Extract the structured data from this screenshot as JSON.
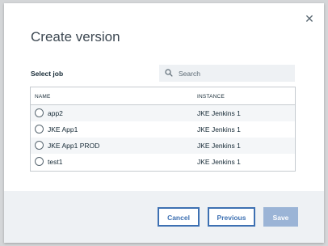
{
  "dialog": {
    "title": "Create version",
    "close_glyph": "✕"
  },
  "job_select": {
    "label": "Select job",
    "search": {
      "placeholder": "Search",
      "icon": "search-icon"
    },
    "columns": [
      "NAME",
      "INSTANCE"
    ],
    "rows": [
      {
        "name": "app2",
        "instance": "JKE Jenkins 1"
      },
      {
        "name": "JKE App1",
        "instance": "JKE Jenkins 1"
      },
      {
        "name": "JKE App1 PROD",
        "instance": "JKE Jenkins 1"
      },
      {
        "name": "test1",
        "instance": "JKE Jenkins 1"
      }
    ]
  },
  "footer": {
    "cancel_label": "Cancel",
    "previous_label": "Previous",
    "save_label": "Save"
  },
  "colors": {
    "primary": "#3d70b2",
    "disabled_primary": "#9bb4d6",
    "footer_bg": "#eef1f4",
    "text": "#152935"
  }
}
